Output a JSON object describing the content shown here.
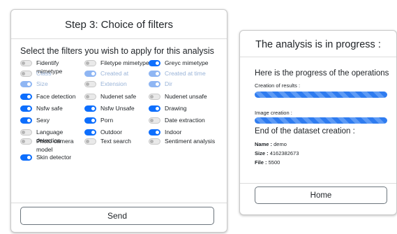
{
  "filters_card": {
    "title": "Step 3: Choice of filters",
    "heading": "Select the filters you wish to apply for this analysis",
    "send_label": "Send",
    "options": [
      {
        "label": "Fidentify mimetype",
        "on": false,
        "disabled": false
      },
      {
        "label": "Filetype mimetype",
        "on": false,
        "disabled": false
      },
      {
        "label": "Greyc mimetype",
        "on": true,
        "disabled": false
      },
      {
        "label": "Class",
        "on": false,
        "disabled": true
      },
      {
        "label": "Created at",
        "on": true,
        "disabled": true
      },
      {
        "label": "Created at time",
        "on": true,
        "disabled": true
      },
      {
        "label": "Size",
        "on": true,
        "disabled": true
      },
      {
        "label": "Extension",
        "on": false,
        "disabled": true
      },
      {
        "label": "Dir",
        "on": true,
        "disabled": true
      },
      {
        "label": "Face detection",
        "on": true,
        "disabled": false
      },
      {
        "label": "Nudenet safe",
        "on": false,
        "disabled": false
      },
      {
        "label": "Nudenet unsafe",
        "on": false,
        "disabled": false
      },
      {
        "label": "Nsfw safe",
        "on": true,
        "disabled": false
      },
      {
        "label": "Nsfw Unsafe",
        "on": true,
        "disabled": false
      },
      {
        "label": "Drawing",
        "on": true,
        "disabled": false
      },
      {
        "label": "Sexy",
        "on": true,
        "disabled": false
      },
      {
        "label": "Porn",
        "on": true,
        "disabled": false
      },
      {
        "label": "Date extraction",
        "on": false,
        "disabled": false
      },
      {
        "label": "Language detection",
        "on": false,
        "disabled": false
      },
      {
        "label": "Outdoor",
        "on": true,
        "disabled": false
      },
      {
        "label": "Indoor",
        "on": true,
        "disabled": false
      },
      {
        "label": "Photo camera model",
        "on": false,
        "disabled": false
      },
      {
        "label": "Text search",
        "on": false,
        "disabled": false
      },
      {
        "label": "Sentiment analysis",
        "on": false,
        "disabled": false
      },
      {
        "label": "Skin detector",
        "on": true,
        "disabled": false
      }
    ]
  },
  "progress_card": {
    "title": "The analysis is in progress :",
    "heading": "Here is the progress of the operations",
    "results_label": "Creation of results :",
    "results_progress": 1.0,
    "image_label": "Image creation :",
    "image_progress": 1.0,
    "end_heading": "End of the dataset creation :",
    "name_key": "Name :",
    "name_value": "demo",
    "size_key": "Size :",
    "size_value": "4162382673",
    "file_key": "File :",
    "file_value": "5500",
    "home_label": "Home"
  },
  "colors": {
    "accent": "#0d6efd",
    "accent_disabled": "#8fb6f3",
    "disabled_text": "#9ab4d8"
  },
  "icons": {
    "switch": "toggle-switch-icon"
  }
}
